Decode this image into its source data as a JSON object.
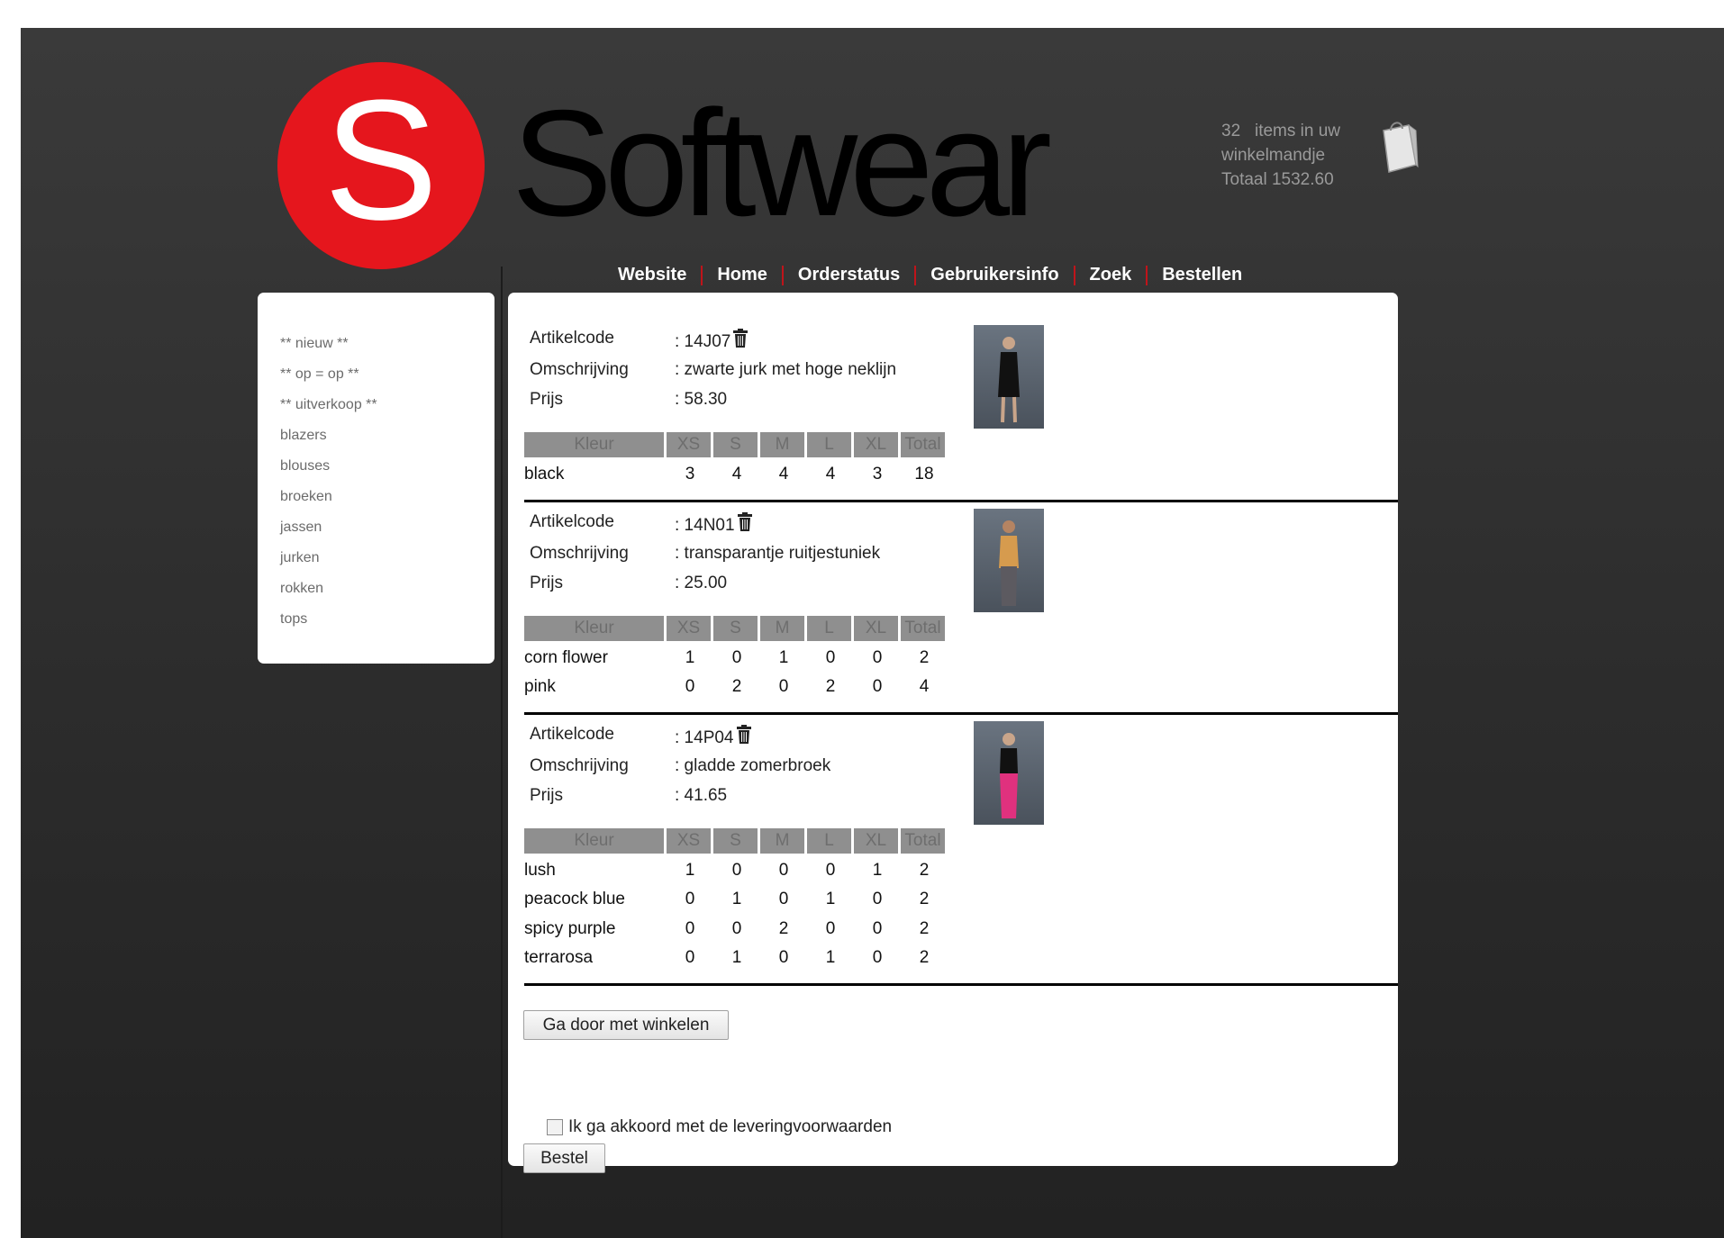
{
  "brand": {
    "logo_letter": "S",
    "name": "Softwear",
    "accent": "#e5161d"
  },
  "cart": {
    "count_line": "32   items in uw",
    "line2": "winkelmandje",
    "total_line": "Totaal 1532.60",
    "icon": "shopping-bag-icon"
  },
  "nav": {
    "items": [
      "Website",
      "Home",
      "Orderstatus",
      "Gebruikersinfo",
      "Zoek",
      "Bestellen"
    ],
    "separator_color": "#c0141a"
  },
  "sidebar": {
    "items": [
      "** nieuw **",
      "** op = op **",
      "** uitverkoop **",
      "blazers",
      "blouses",
      "broeken",
      "jassen",
      "jurken",
      "rokken",
      "tops"
    ]
  },
  "labels": {
    "code": "Artikelcode",
    "desc": "Omschrijving",
    "price": "Prijs"
  },
  "size_headers": [
    "Kleur",
    "XS",
    "S",
    "M",
    "L",
    "XL",
    "Total"
  ],
  "products": [
    {
      "code": ": 14J07",
      "desc": ": zwarte jurk met hoge neklijn",
      "price": ": 58.30",
      "rows": [
        {
          "color": "black",
          "xs": "3",
          "s": "4",
          "m": "4",
          "l": "4",
          "xl": "3",
          "total": "18"
        }
      ]
    },
    {
      "code": ": 14N01",
      "desc": ": transparantje ruitjestuniek",
      "price": ": 25.00",
      "rows": [
        {
          "color": "corn flower",
          "xs": "1",
          "s": "0",
          "m": "1",
          "l": "0",
          "xl": "0",
          "total": "2"
        },
        {
          "color": "pink",
          "xs": "0",
          "s": "2",
          "m": "0",
          "l": "2",
          "xl": "0",
          "total": "4"
        }
      ]
    },
    {
      "code": ": 14P04",
      "desc": ": gladde zomerbroek",
      "price": ": 41.65",
      "rows": [
        {
          "color": "lush",
          "xs": "1",
          "s": "0",
          "m": "0",
          "l": "0",
          "xl": "1",
          "total": "2"
        },
        {
          "color": "peacock blue",
          "xs": "0",
          "s": "1",
          "m": "0",
          "l": "1",
          "xl": "0",
          "total": "2"
        },
        {
          "color": "spicy purple",
          "xs": "0",
          "s": "0",
          "m": "2",
          "l": "0",
          "xl": "0",
          "total": "2"
        },
        {
          "color": "terrarosa",
          "xs": "0",
          "s": "1",
          "m": "0",
          "l": "1",
          "xl": "0",
          "total": "2"
        }
      ]
    }
  ],
  "actions": {
    "continue_label": "Ga door met winkelen",
    "agree_label": "Ik ga akkoord met de leveringvoorwaarden",
    "agree_checked": false,
    "order_label": "Bestel"
  }
}
